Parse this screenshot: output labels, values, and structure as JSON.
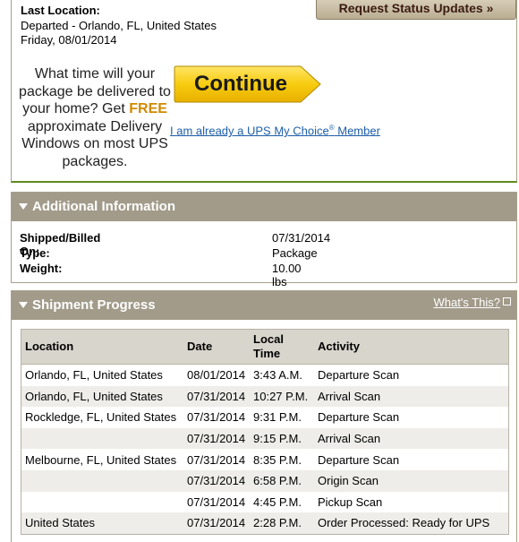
{
  "last_location": {
    "label": "Last Location:",
    "line1": "Departed - Orlando, FL, United States",
    "line2": "Friday, 08/01/2014"
  },
  "status_button": "Request Status Updates »",
  "promo": {
    "text_before": "What time will your package be delivered to your home? Get",
    "free": "FREE",
    "text_after": "approximate Delivery Windows on most UPS packages."
  },
  "continue_label": "Continue",
  "member_link": {
    "text": "I am already a UPS My Choice",
    "reg": "®",
    "suffix": " Member"
  },
  "additional_info": {
    "title": "Additional Information",
    "rows": [
      {
        "key": "Shipped/Billed On:",
        "value": "07/31/2014"
      },
      {
        "key": "Type:",
        "value": "Package"
      },
      {
        "key": "Weight:",
        "value": "10.00 lbs"
      }
    ]
  },
  "shipment_progress": {
    "title": "Shipment Progress",
    "whats_this": "What's This?",
    "headers": {
      "location": "Location",
      "date": "Date",
      "time_l1": "Local",
      "time_l2": "Time",
      "activity": "Activity"
    },
    "rows": [
      {
        "location": "Orlando, FL, United States",
        "date": "08/01/2014",
        "time": "3:43 A.M.",
        "activity": "Departure Scan"
      },
      {
        "location": "Orlando, FL, United States",
        "date": "07/31/2014",
        "time": "10:27 P.M.",
        "activity": "Arrival Scan"
      },
      {
        "location": "Rockledge, FL, United States",
        "date": "07/31/2014",
        "time": "9:31 P.M.",
        "activity": "Departure Scan"
      },
      {
        "location": "",
        "date": "07/31/2014",
        "time": "9:15 P.M.",
        "activity": "Arrival Scan"
      },
      {
        "location": "Melbourne, FL, United States",
        "date": "07/31/2014",
        "time": "8:35 P.M.",
        "activity": "Departure Scan"
      },
      {
        "location": "",
        "date": "07/31/2014",
        "time": "6:58 P.M.",
        "activity": "Origin Scan"
      },
      {
        "location": "",
        "date": "07/31/2014",
        "time": "4:45 P.M.",
        "activity": "Pickup Scan"
      },
      {
        "location": "United States",
        "date": "07/31/2014",
        "time": "2:28 P.M.",
        "activity": "Order Processed: Ready for UPS"
      }
    ]
  },
  "colors": {
    "header_bar": "#a29b8a",
    "button_yellow": "#f5c400",
    "link": "#1f5fa8",
    "free": "#d08a00"
  }
}
